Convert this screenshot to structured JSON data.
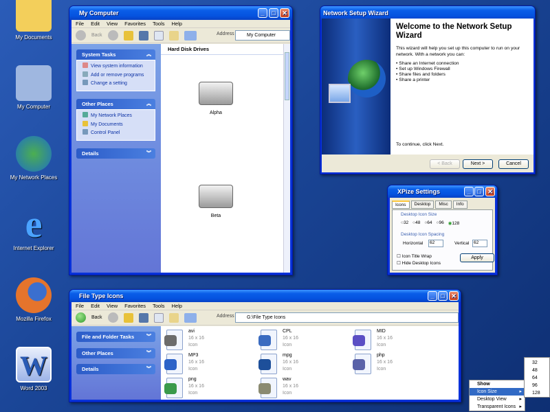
{
  "desktop": {
    "icons": [
      {
        "label": "My Documents",
        "color": "#f3cf5b"
      },
      {
        "label": "My Computer",
        "color": "#9fb7e0"
      },
      {
        "label": "My Network Places",
        "color": "#3d9b4a"
      },
      {
        "label": "Internet Explorer",
        "color": "#1e8ae8"
      },
      {
        "label": "Mozilla Firefox",
        "color": "#e5742c"
      },
      {
        "label": "Word 2003",
        "color": "#2a5bb5"
      }
    ]
  },
  "my_computer": {
    "title": "My Computer",
    "menu": [
      "File",
      "Edit",
      "View",
      "Favorites",
      "Tools",
      "Help"
    ],
    "toolbar": {
      "back": "Back",
      "address_label": "Address",
      "address_value": "My Computer"
    },
    "system_tasks": {
      "title": "System Tasks",
      "items": [
        "View system information",
        "Add or remove programs",
        "Change a setting"
      ]
    },
    "other_places": {
      "title": "Other Places",
      "items": [
        "My Network Places",
        "My Documents",
        "Control Panel"
      ]
    },
    "details": {
      "title": "Details"
    },
    "section": "Hard Disk Drives",
    "drives": [
      "Alpha",
      "Beta"
    ]
  },
  "wizard": {
    "title": "Network Setup Wizard",
    "heading": "Welcome to the Network Setup Wizard",
    "intro": "This wizard will help you set up this computer to run on your network. With a network you can:",
    "bullets": [
      "Share an Internet connection",
      "Set up Windows Firewall",
      "Share files and folders",
      "Share a printer"
    ],
    "continue": "To continue, click Next.",
    "buttons": {
      "back": "< Back",
      "next": "Next >",
      "cancel": "Cancel"
    }
  },
  "xpize": {
    "title": "XPize Settings",
    "tabs": [
      "Icons",
      "Desktop",
      "Misc",
      "Info"
    ],
    "active_tab": "Icons",
    "icon_size": {
      "label": "Desktop Icon Size",
      "options": [
        "32",
        "48",
        "64",
        "96",
        "128"
      ],
      "selected": "128"
    },
    "spacing": {
      "label": "Desktop Icon Spacing",
      "horizontal_label": "Horizontal",
      "horizontal": "62",
      "vertical_label": "Vertical",
      "vertical": "62"
    },
    "checkboxes": [
      {
        "label": "Icon Title Wrap",
        "checked": false
      },
      {
        "label": "Hide Desktop Icons",
        "checked": false
      }
    ],
    "apply": "Apply"
  },
  "file_types": {
    "title": "File Type Icons",
    "menu": [
      "File",
      "Edit",
      "View",
      "Favorites",
      "Tools",
      "Help"
    ],
    "toolbar": {
      "back": "Back",
      "address_label": "Address",
      "address_value": "G:\\File Type Icons"
    },
    "panels": [
      "File and Folder Tasks",
      "Other Places",
      "Details"
    ],
    "files": [
      {
        "name": "avi",
        "size": "16 x 16",
        "type": "Icon",
        "color": "#6b6b6b"
      },
      {
        "name": "CPL",
        "size": "16 x 16",
        "type": "Icon",
        "color": "#3a6bc0"
      },
      {
        "name": "MID",
        "size": "16 x 16",
        "type": "Icon",
        "color": "#5b4fc4"
      },
      {
        "name": "MP3",
        "size": "16 x 16",
        "type": "Icon",
        "color": "#2d63c8"
      },
      {
        "name": "mpg",
        "size": "16 x 16",
        "type": "Icon",
        "color": "#1d4f9a"
      },
      {
        "name": "php",
        "size": "16 x 16",
        "type": "Icon",
        "color": "#5a62a8"
      },
      {
        "name": "png",
        "size": "16 x 16",
        "type": "Icon",
        "color": "#3a9a4a"
      },
      {
        "name": "wav",
        "size": "16 x 16",
        "type": "Icon",
        "color": "#8a8a70"
      }
    ]
  },
  "context_menu": {
    "items": [
      "Show",
      "Icon Size",
      "Desktop View",
      "Transparent Icons"
    ],
    "highlighted": "Icon Size",
    "submenu": [
      "32",
      "48",
      "64",
      "96",
      "128"
    ]
  }
}
